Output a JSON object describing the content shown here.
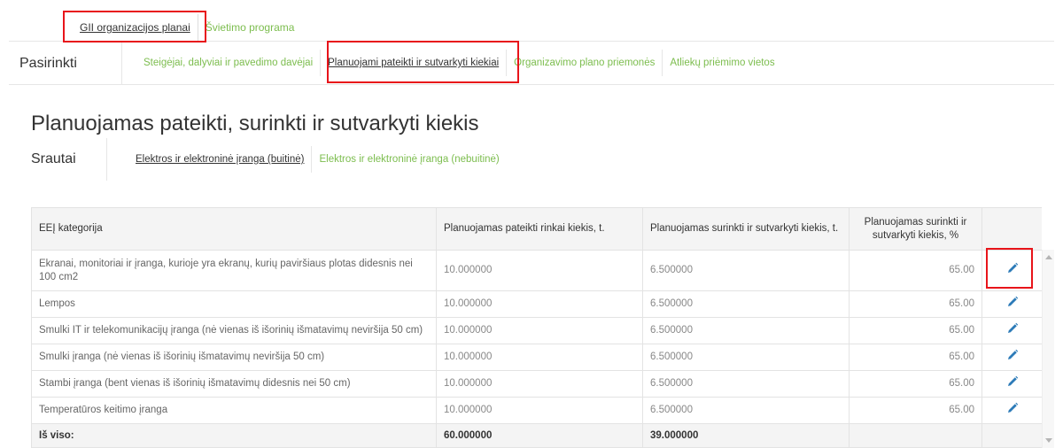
{
  "top_tabs": [
    {
      "label": "GII organizacijos planai",
      "active": true
    },
    {
      "label": "Švietimo programa",
      "active": false
    }
  ],
  "select_bar": {
    "label": "Pasirinkti",
    "items": [
      {
        "label": "Steigėjai, dalyviai ir pavedimo davėjai",
        "active": false
      },
      {
        "label": "Planuojami pateikti ir sutvarkyti kiekiai",
        "active": true
      },
      {
        "label": "Organizavimo plano priemonės",
        "active": false
      },
      {
        "label": "Atliekų priėmimo vietos",
        "active": false
      }
    ]
  },
  "page_title": "Planuojamas pateikti, surinkti ir sutvarkyti kiekis",
  "streams": {
    "label": "Srautai",
    "items": [
      {
        "label": "Elektros ir elektroninė įranga (buitinė)",
        "active": true
      },
      {
        "label": "Elektros ir elektroninė įranga (nebuitinė)",
        "active": false
      }
    ]
  },
  "table": {
    "headers": {
      "category": "EEĮ kategorija",
      "placed": "Planuojamas pateikti rinkai kiekis, t.",
      "collected": "Planuojamas surinkti ir sutvarkyti kiekis, t.",
      "percent": "Planuojamas surinkti ir sutvarkyti kiekis, %"
    },
    "rows": [
      {
        "category": "Ekranai, monitoriai ir įranga, kurioje yra ekranų, kurių paviršiaus plotas didesnis nei 100 cm2",
        "placed": "10.000000",
        "collected": "6.500000",
        "percent": "65.00"
      },
      {
        "category": "Lempos",
        "placed": "10.000000",
        "collected": "6.500000",
        "percent": "65.00"
      },
      {
        "category": "Smulki IT ir telekomunikacijų įranga (nė vienas iš išorinių išmatavimų neviršija 50 cm)",
        "placed": "10.000000",
        "collected": "6.500000",
        "percent": "65.00"
      },
      {
        "category": "Smulki įranga (nė vienas iš išorinių išmatavimų neviršija 50 cm)",
        "placed": "10.000000",
        "collected": "6.500000",
        "percent": "65.00"
      },
      {
        "category": "Stambi įranga (bent vienas iš išorinių išmatavimų didesnis nei 50 cm)",
        "placed": "10.000000",
        "collected": "6.500000",
        "percent": "65.00"
      },
      {
        "category": "Temperatūros keitimo įranga",
        "placed": "10.000000",
        "collected": "6.500000",
        "percent": "65.00"
      }
    ],
    "total": {
      "label": "Iš viso:",
      "placed": "60.000000",
      "collected": "39.000000"
    }
  },
  "icons": {
    "edit": "pencil-icon"
  },
  "colors": {
    "link": "#7cbd4e",
    "edit_icon": "#2d7bb8",
    "highlight": "#e8141a",
    "header_bg": "#f4f4f4"
  }
}
